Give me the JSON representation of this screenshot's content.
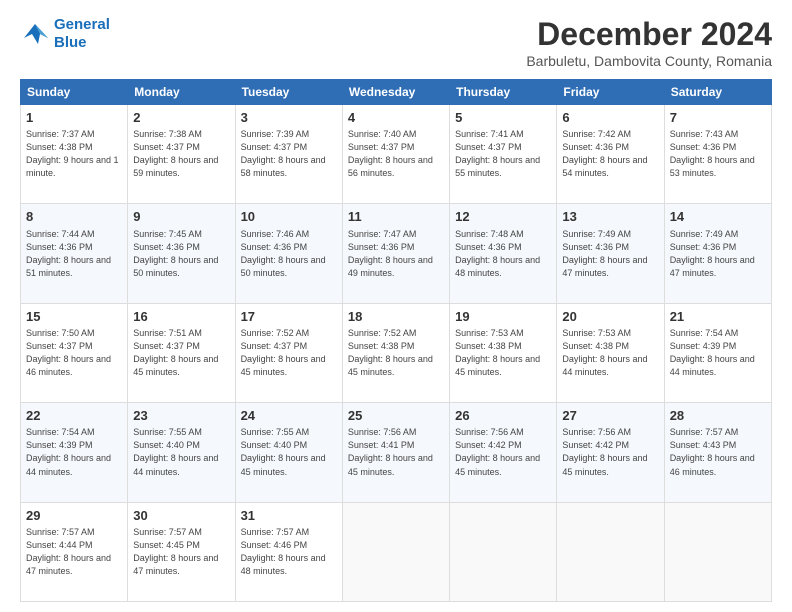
{
  "logo": {
    "line1": "General",
    "line2": "Blue"
  },
  "title": "December 2024",
  "location": "Barbuletu, Dambovita County, Romania",
  "days_of_week": [
    "Sunday",
    "Monday",
    "Tuesday",
    "Wednesday",
    "Thursday",
    "Friday",
    "Saturday"
  ],
  "weeks": [
    [
      {
        "day": 1,
        "info": "Sunrise: 7:37 AM\nSunset: 4:38 PM\nDaylight: 9 hours and 1 minute."
      },
      {
        "day": 2,
        "info": "Sunrise: 7:38 AM\nSunset: 4:37 PM\nDaylight: 8 hours and 59 minutes."
      },
      {
        "day": 3,
        "info": "Sunrise: 7:39 AM\nSunset: 4:37 PM\nDaylight: 8 hours and 58 minutes."
      },
      {
        "day": 4,
        "info": "Sunrise: 7:40 AM\nSunset: 4:37 PM\nDaylight: 8 hours and 56 minutes."
      },
      {
        "day": 5,
        "info": "Sunrise: 7:41 AM\nSunset: 4:37 PM\nDaylight: 8 hours and 55 minutes."
      },
      {
        "day": 6,
        "info": "Sunrise: 7:42 AM\nSunset: 4:36 PM\nDaylight: 8 hours and 54 minutes."
      },
      {
        "day": 7,
        "info": "Sunrise: 7:43 AM\nSunset: 4:36 PM\nDaylight: 8 hours and 53 minutes."
      }
    ],
    [
      {
        "day": 8,
        "info": "Sunrise: 7:44 AM\nSunset: 4:36 PM\nDaylight: 8 hours and 51 minutes."
      },
      {
        "day": 9,
        "info": "Sunrise: 7:45 AM\nSunset: 4:36 PM\nDaylight: 8 hours and 50 minutes."
      },
      {
        "day": 10,
        "info": "Sunrise: 7:46 AM\nSunset: 4:36 PM\nDaylight: 8 hours and 50 minutes."
      },
      {
        "day": 11,
        "info": "Sunrise: 7:47 AM\nSunset: 4:36 PM\nDaylight: 8 hours and 49 minutes."
      },
      {
        "day": 12,
        "info": "Sunrise: 7:48 AM\nSunset: 4:36 PM\nDaylight: 8 hours and 48 minutes."
      },
      {
        "day": 13,
        "info": "Sunrise: 7:49 AM\nSunset: 4:36 PM\nDaylight: 8 hours and 47 minutes."
      },
      {
        "day": 14,
        "info": "Sunrise: 7:49 AM\nSunset: 4:36 PM\nDaylight: 8 hours and 47 minutes."
      }
    ],
    [
      {
        "day": 15,
        "info": "Sunrise: 7:50 AM\nSunset: 4:37 PM\nDaylight: 8 hours and 46 minutes."
      },
      {
        "day": 16,
        "info": "Sunrise: 7:51 AM\nSunset: 4:37 PM\nDaylight: 8 hours and 45 minutes."
      },
      {
        "day": 17,
        "info": "Sunrise: 7:52 AM\nSunset: 4:37 PM\nDaylight: 8 hours and 45 minutes."
      },
      {
        "day": 18,
        "info": "Sunrise: 7:52 AM\nSunset: 4:38 PM\nDaylight: 8 hours and 45 minutes."
      },
      {
        "day": 19,
        "info": "Sunrise: 7:53 AM\nSunset: 4:38 PM\nDaylight: 8 hours and 45 minutes."
      },
      {
        "day": 20,
        "info": "Sunrise: 7:53 AM\nSunset: 4:38 PM\nDaylight: 8 hours and 44 minutes."
      },
      {
        "day": 21,
        "info": "Sunrise: 7:54 AM\nSunset: 4:39 PM\nDaylight: 8 hours and 44 minutes."
      }
    ],
    [
      {
        "day": 22,
        "info": "Sunrise: 7:54 AM\nSunset: 4:39 PM\nDaylight: 8 hours and 44 minutes."
      },
      {
        "day": 23,
        "info": "Sunrise: 7:55 AM\nSunset: 4:40 PM\nDaylight: 8 hours and 44 minutes."
      },
      {
        "day": 24,
        "info": "Sunrise: 7:55 AM\nSunset: 4:40 PM\nDaylight: 8 hours and 45 minutes."
      },
      {
        "day": 25,
        "info": "Sunrise: 7:56 AM\nSunset: 4:41 PM\nDaylight: 8 hours and 45 minutes."
      },
      {
        "day": 26,
        "info": "Sunrise: 7:56 AM\nSunset: 4:42 PM\nDaylight: 8 hours and 45 minutes."
      },
      {
        "day": 27,
        "info": "Sunrise: 7:56 AM\nSunset: 4:42 PM\nDaylight: 8 hours and 45 minutes."
      },
      {
        "day": 28,
        "info": "Sunrise: 7:57 AM\nSunset: 4:43 PM\nDaylight: 8 hours and 46 minutes."
      }
    ],
    [
      {
        "day": 29,
        "info": "Sunrise: 7:57 AM\nSunset: 4:44 PM\nDaylight: 8 hours and 47 minutes."
      },
      {
        "day": 30,
        "info": "Sunrise: 7:57 AM\nSunset: 4:45 PM\nDaylight: 8 hours and 47 minutes."
      },
      {
        "day": 31,
        "info": "Sunrise: 7:57 AM\nSunset: 4:46 PM\nDaylight: 8 hours and 48 minutes."
      },
      null,
      null,
      null,
      null
    ]
  ]
}
